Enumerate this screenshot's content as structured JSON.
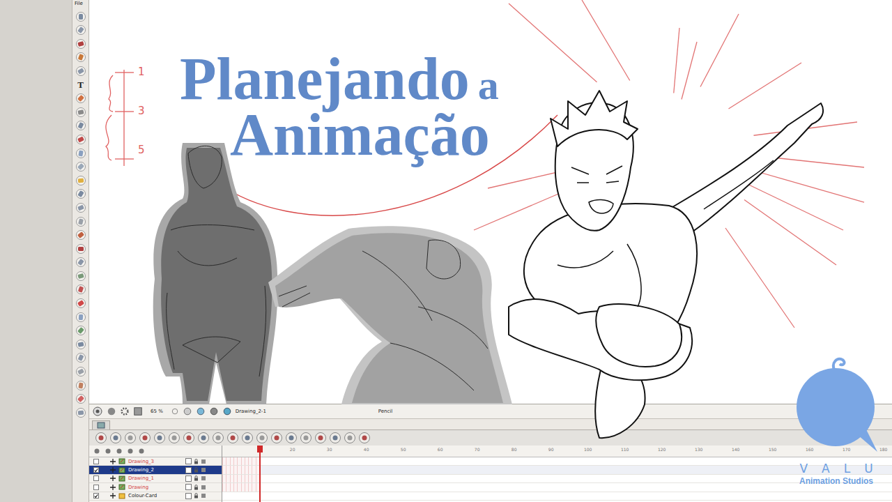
{
  "menu": {
    "label": "File"
  },
  "toolbar": {
    "text_tool": "T"
  },
  "title": {
    "line1": "Planejando",
    "connector": "a",
    "line2": "Animação"
  },
  "ruler": {
    "marks": [
      "1",
      "3",
      "5"
    ]
  },
  "timeline": {
    "zoom": "65 %",
    "drawing": "Drawing_2-1",
    "tool": "Pencil",
    "frame_ticks": [
      "20",
      "30",
      "40",
      "50",
      "60",
      "70",
      "80",
      "90",
      "100",
      "110",
      "120",
      "130",
      "140",
      "150",
      "160",
      "170",
      "180"
    ],
    "playhead": {
      "level": 0.055
    },
    "layers": [
      {
        "name": "Drawing_3",
        "kind": "drawing",
        "visible": false,
        "selected": false,
        "color": "#d23c3c"
      },
      {
        "name": "Drawing_2",
        "kind": "drawing",
        "visible": true,
        "selected": true,
        "color": "#ffffff"
      },
      {
        "name": "Drawing_1",
        "kind": "drawing",
        "visible": false,
        "selected": false,
        "color": "#d23c3c"
      },
      {
        "name": "Drawing",
        "kind": "drawing",
        "visible": false,
        "selected": false,
        "color": "#d23c3c"
      },
      {
        "name": "Colour-Card",
        "kind": "colour-card",
        "visible": true,
        "selected": false,
        "color": "#1a1a1a"
      }
    ]
  },
  "logo": {
    "letters": [
      "V",
      "A",
      "L",
      "U"
    ],
    "subtitle": "Animation Studios"
  }
}
